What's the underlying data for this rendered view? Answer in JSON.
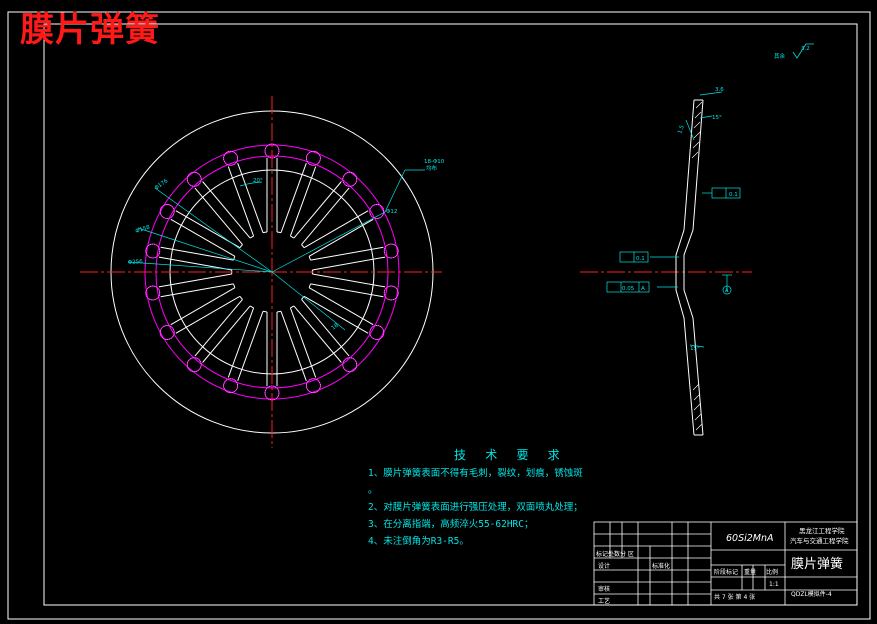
{
  "overlay_title": "膜片弹簧",
  "tech_requirements": {
    "title": "技 术 要 求",
    "items": [
      "1、膜片弹簧表面不得有毛刺，裂纹，划痕，锈蚀斑",
      "。",
      "2、对膜片弹簧表面进行强压处理，双面喷丸处理；",
      "3、在分离指端，高频淬火55-62HRC；",
      "4、未注倒角为R3-R5。"
    ]
  },
  "title_block": {
    "material": "60Si2MnA",
    "school_line1": "黑龙江工程学院",
    "school_line2": "汽车与交通工程学院",
    "part_name": "膜片弹簧",
    "drawing_no": "QDZL模拟件-4",
    "scale": "1:1",
    "sheet_info": "共 7 张   第 4 张",
    "label_stage": "阶段标记",
    "label_weight": "重量",
    "label_scale": "比例",
    "label_mark": "标记处数分  区",
    "label_design": "设计",
    "label_std": "标准化",
    "label_review": "审核",
    "label_process": "工艺"
  },
  "annotations": {
    "roughness": "其余",
    "roughness_value": "3.2",
    "tol_flat_1": "0.1",
    "tol_flat_2": "0.1",
    "tol_parallel": "0.05",
    "datum": "A",
    "datum_symbol": "A",
    "dim_thickness": "3.6",
    "dim_angle_top": "15°",
    "dim_angle_bottom": "15°",
    "dim_small": "1.5",
    "dim_diam_1": "Φ176",
    "dim_diam_2": "Φ158",
    "dim_diam_3": "Φ256",
    "dim_hole": "Φ12",
    "dim_slot": "18",
    "dim_angle_slot": "20°",
    "note_hole": "18-Φ10",
    "note_hole_2": "均布"
  },
  "colors": {
    "background": "#000000",
    "outline": "#ffffff",
    "center_line": "#ff2020",
    "dimension": "#00e5e5",
    "holes": "#ff00ff",
    "title_overlay": "#ff1a1a"
  }
}
